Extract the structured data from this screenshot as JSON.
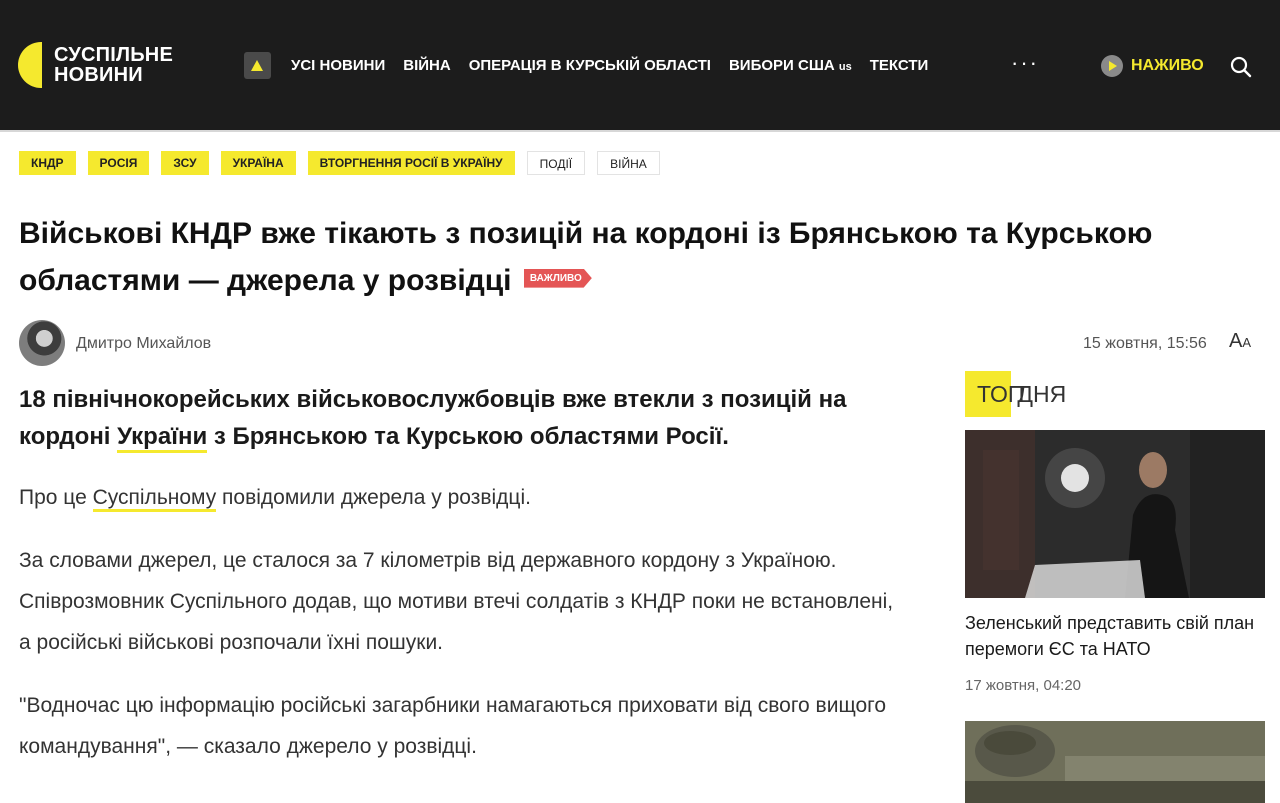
{
  "header": {
    "logo_line1": "СУСПІЛЬНЕ",
    "logo_line2": "НОВИНИ",
    "nav": [
      "УСІ НОВИНИ",
      "ВІЙНА",
      "ОПЕРАЦІЯ В КУРСЬКІЙ ОБЛАСТІ",
      "ВИБОРИ США"
    ],
    "us_badge": "us",
    "nav_last": "ТЕКСТИ",
    "more": "···",
    "live_label": "НАЖИВО"
  },
  "tags": {
    "yellow": [
      "КНДР",
      "РОСІЯ",
      "ЗСУ",
      "УКРАЇНА",
      "ВТОРГНЕННЯ РОСІЇ В УКРАЇНУ"
    ],
    "plain": [
      "ПОДІЇ",
      "ВІЙНА"
    ]
  },
  "article": {
    "title": "Військові КНДР вже тікають з позицій на кордоні із Брянською та Курською областями — джерела у розвідці",
    "badge": "ВАЖЛИВО",
    "author": "Дмитро Михайлов",
    "date": "15 жовтня, 15:56",
    "font_size_icon": "A",
    "lead_part1": "18 північнокорейських військовослужбовців вже втекли з позицій на кордоні ",
    "lead_link": "України",
    "lead_part2": " з Брянською та Курською областями Росії.",
    "p1_part1": "Про це ",
    "p1_link": "Суспільному",
    "p1_part2": " повідомили джерела у розвідці.",
    "p2": "За словами джерел, це сталося за 7 кілометрів від державного кордону з Україною. Співрозмовник Суспільного додав, що мотиви втечі солдатів з КНДР поки не встановлені, а російські військові розпочали їхні пошуки.",
    "p3": "\"Водночас цю інформацію російські загарбники намагаються приховати від свого вищого командування\", — сказало джерело у розвідці."
  },
  "sidebar": {
    "head_highlight": "ТОП",
    "head_rest": " ДНЯ",
    "cards": [
      {
        "title": "Зеленський представить свій план перемоги ЄС та НАТО",
        "date": "17 жовтня, 04:20"
      }
    ]
  },
  "colors": {
    "header_bg": "#1c1c1c",
    "accent_yellow": "#f5e92e",
    "badge_red": "#e45555"
  }
}
